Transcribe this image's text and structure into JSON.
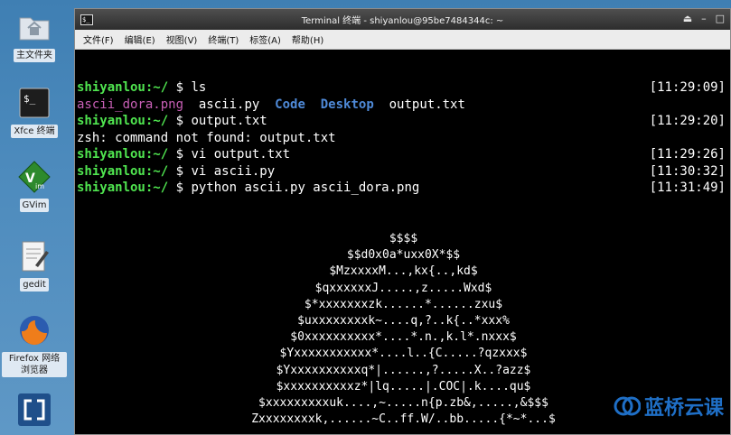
{
  "desktop": {
    "icons": [
      {
        "label": "主文件夹",
        "icon": "folder-icon"
      },
      {
        "label": "Xfce 终端",
        "icon": "terminal-icon"
      },
      {
        "label": "GVim",
        "icon": "vim-icon"
      },
      {
        "label": "gedit",
        "icon": "text-editor-icon"
      },
      {
        "label": "Firefox 网络浏览器",
        "icon": "firefox-icon"
      },
      {
        "label": "",
        "icon": "app-icon"
      }
    ]
  },
  "window": {
    "title": "Terminal 终端 - shiyanlou@95be7484344c: ~",
    "menu": [
      "文件(F)",
      "编辑(E)",
      "视图(V)",
      "终端(T)",
      "标签(A)",
      "帮助(H)"
    ]
  },
  "terminal": {
    "prompt_user": "shiyanlou",
    "prompt_path": ":~/",
    "prompt_symbol": " $ ",
    "lines": [
      {
        "type": "cmd",
        "cmd": "ls",
        "time": "[11:29:09]"
      },
      {
        "type": "ls",
        "files": [
          "ascii_dora.png",
          "ascii.py",
          "Code",
          "Desktop",
          "output.txt"
        ]
      },
      {
        "type": "cmd",
        "cmd": "output.txt",
        "time": "[11:29:20]"
      },
      {
        "type": "out",
        "text": "zsh: command not found: output.txt"
      },
      {
        "type": "cmd",
        "cmd": "vi output.txt",
        "time": "[11:29:26]"
      },
      {
        "type": "cmd",
        "cmd": "vi ascii.py",
        "time": "[11:30:32]"
      },
      {
        "type": "cmd",
        "cmd": "python ascii.py ascii_dora.png",
        "time": "[11:31:49]"
      }
    ],
    "art": [
      "$$$$",
      "$$d0x0a*uxx0X*$$",
      "$MzxxxxM...,kx{..,kd$",
      "$qxxxxxxJ.....,z.....Wxd$",
      "$*xxxxxxxzk......*......zxu$",
      "$uxxxxxxxxk~....q,?..k{..*xxx%",
      "$0xxxxxxxxxx*....*.n.,k.l*.nxxx$",
      "$Yxxxxxxxxxxx*....l..{C.....?qzxxx$",
      "$Yxxxxxxxxxxq*|......,?.....X..?azz$",
      "$xxxxxxxxxxz*|lq.....|.COC|.k....qu$",
      "$xxxxxxxxxuk....,~.....n{p.zb&,.....,&$$$",
      "Zxxxxxxxxk,......~C..ff.W/..bb.....{*~*...$"
    ]
  },
  "watermark": {
    "text": "蓝桥云课"
  },
  "colors": {
    "user": "#50e650",
    "png": "#c75fb5",
    "dir": "#4f8ad8"
  }
}
